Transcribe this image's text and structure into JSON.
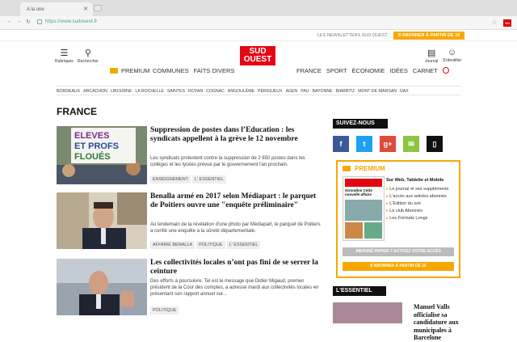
{
  "browser": {
    "tab_title": "A la une",
    "url": "https://www.sudouest.fr"
  },
  "topbar": {
    "newsletters": "LES NEWSLETTERS SUD OUEST",
    "subscribe": "S'ABONNER À PARTIR DE 1€"
  },
  "header": {
    "left_icons": [
      {
        "label": "Rubriques",
        "icon": "menu-icon"
      },
      {
        "label": "Rechercher",
        "icon": "search-icon"
      }
    ],
    "right_icons": [
      {
        "label": "Journal",
        "icon": "newspaper-icon"
      },
      {
        "label": "S'identifier",
        "icon": "user-icon"
      }
    ],
    "logo_line1": "SUD",
    "logo_line2": "OUEST",
    "premium": "PREMIUM",
    "nav_left": [
      "COMMUNES",
      "FAITS DIVERS"
    ],
    "nav_right": [
      "FRANCE",
      "SPORT",
      "ÉCONOMIE",
      "IDÉES",
      "CARNET"
    ],
    "cities": [
      "BORDEAUX",
      "ARCACHON",
      "LIBOURNE",
      "LA ROCHELLE",
      "SAINTES",
      "ROYAN",
      "COGNAC",
      "ANGOULÊME",
      "PÉRIGUEUX",
      "AGEN",
      "PAU",
      "BAYONNE",
      "BIARRITZ",
      "MONT-DE-MARSAN",
      "DAX"
    ]
  },
  "section": {
    "title": "FRANCE"
  },
  "articles": [
    {
      "title": "Suppression de postes dans l’Education : les syndicats appellent à la grève le 12 novembre",
      "desc": "Les syndicats protestent contre la suppression de 2 650 postes dans les collèges et les lycées prévue par le gouvernement l'an prochain.",
      "tags": [
        "ENSEIGNEMENT",
        "L' ESSENTIEL"
      ],
      "thumb_text": "ELEVES ET PROFS FLOUÉS"
    },
    {
      "title": "Benalla armé en 2017 selon Médiapart : le parquet de Poitiers ouvre une \"enquête préliminaire\"",
      "desc": "Au lendemain de la révélation d'une photo par Médiapart, le parquet de Poitiers a confié une enquête à la sûreté départementale.",
      "tags": [
        "AFFAIRE BENALLA",
        "POLITIQUE",
        "L' ESSENTIEL"
      ]
    },
    {
      "title": "Les collectivités locales n’ont pas fini de se serrer la ceinture",
      "desc": "Des efforts à poursuivre. Tel est le message que Didier Migaud, premier président de la Cour des comptes, a adressé mardi aux collectivités locales en présentant son rapport annuel sur...",
      "tags": [
        "POLITIQUE"
      ]
    }
  ],
  "sidebar": {
    "suivez": "SUIVEZ-NOUS",
    "social": [
      {
        "icon": "facebook-icon",
        "glyph": "f",
        "color": "#3b5998"
      },
      {
        "icon": "twitter-icon",
        "glyph": "t",
        "color": "#1da1f2"
      },
      {
        "icon": "googleplus-icon",
        "glyph": "g+",
        "color": "#dd4b39"
      },
      {
        "icon": "mail-icon",
        "glyph": "✉",
        "color": "#8dc63f"
      },
      {
        "icon": "mobile-icon",
        "glyph": "▯",
        "color": "#111"
      }
    ],
    "premium": {
      "label": "PREMIUM",
      "title": "Sur Web, Tablette et Mobile",
      "items": [
        "Le journal et ses suppléments",
        "L'accès aux articles abonnés",
        "L'Edition du soir",
        "Le club Abonnés",
        "Les Formats Longs"
      ],
      "paper_headline": "Girondins Cette nouvelle affaire",
      "btn_already": "ABONNÉ PAPIER ? ACTIVEZ VOTRE ACCÈS",
      "btn_subscribe": "S'ABONNER À PARTIR DE 1€"
    },
    "essentiel": "L'ESSENTIEL",
    "essentiel_title": "Manuel Valls officialise sa candidature aux municipales à Barcelone"
  },
  "colors": {
    "brand_red": "#e30613",
    "premium_orange": "#f7a800"
  }
}
